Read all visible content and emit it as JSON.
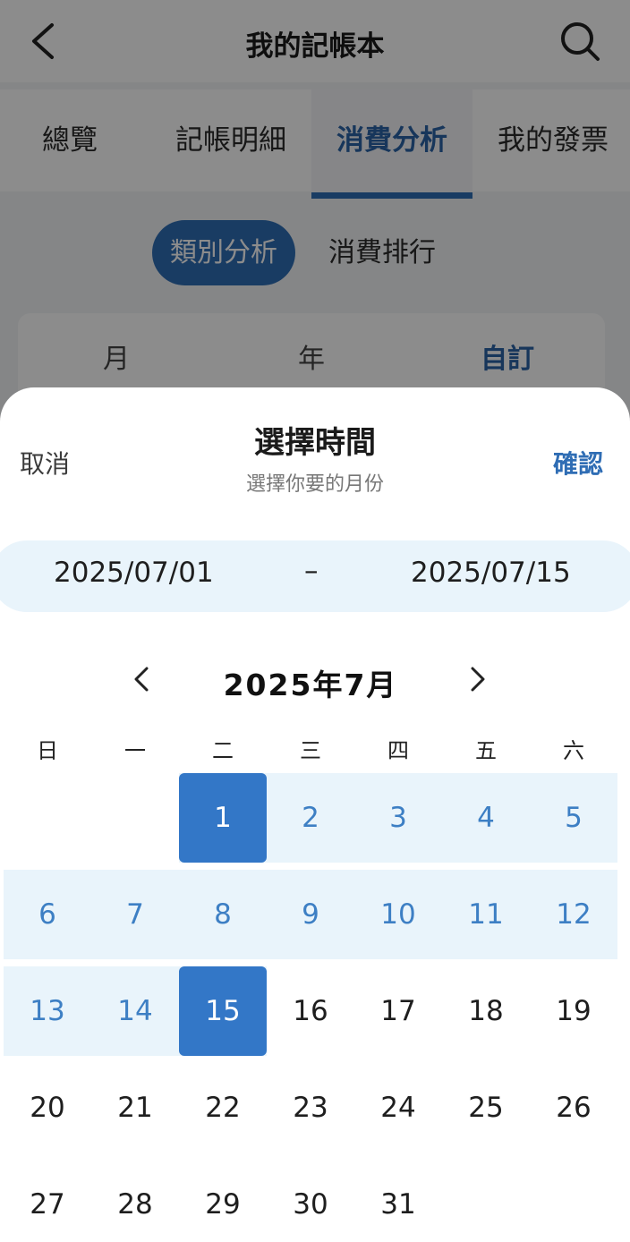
{
  "header": {
    "title": "我的記帳本",
    "back_icon": "chevron-left-icon",
    "search_icon": "search-icon"
  },
  "tabs": [
    {
      "label": "總覽"
    },
    {
      "label": "記帳明細"
    },
    {
      "label": "消費分析"
    },
    {
      "label": "我的發票"
    }
  ],
  "active_tab": "消費分析",
  "segments": [
    {
      "label": "類別分析"
    },
    {
      "label": "消費排行"
    }
  ],
  "period_options": [
    {
      "label": "月"
    },
    {
      "label": "年"
    },
    {
      "label": "自訂"
    }
  ],
  "sheet": {
    "cancel_label": "取消",
    "confirm_label": "確認",
    "title": "選擇時間",
    "subtitle": "選擇你要的月份",
    "range": {
      "start": "2025/07/01",
      "separator": "–",
      "end": "2025/07/15"
    },
    "calendar": {
      "month_title": "2025年7月",
      "weekdays": [
        "日",
        "一",
        "二",
        "三",
        "四",
        "五",
        "六"
      ],
      "days": [
        "1",
        "2",
        "3",
        "4",
        "5",
        "6",
        "7",
        "8",
        "9",
        "10",
        "11",
        "12",
        "13",
        "14",
        "15",
        "16",
        "17",
        "18",
        "19",
        "20",
        "21",
        "22",
        "23",
        "24",
        "25",
        "26",
        "27",
        "28",
        "29",
        "30",
        "31"
      ],
      "first_weekday_index": 2,
      "selected_start": 1,
      "selected_end": 15
    }
  },
  "colors": {
    "accent": "#2f6db4",
    "selected_day": "#3377c7",
    "range_fill": "#e9f4fb",
    "range_text": "#3d7fc4"
  }
}
